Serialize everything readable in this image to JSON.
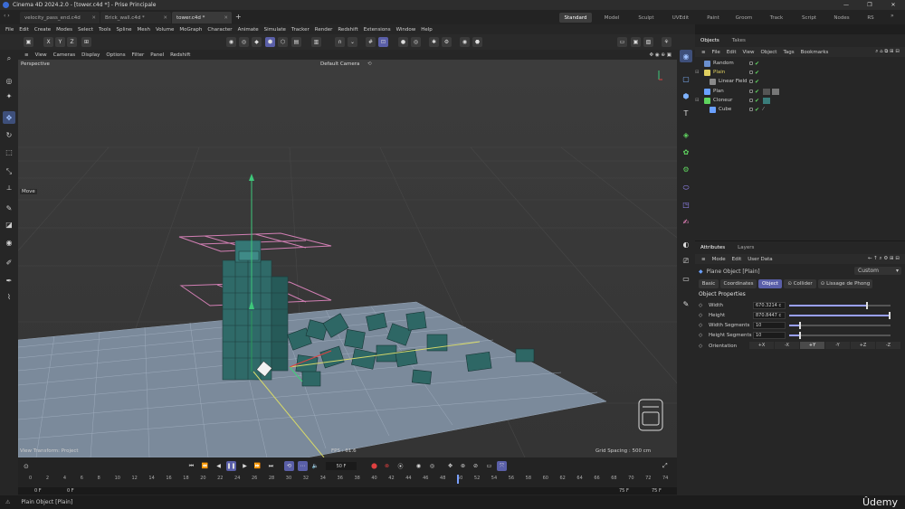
{
  "window": {
    "title": "Cinema 4D 2024.2.0 - [tower.c4d *] - Prise Principale",
    "controls": [
      "—",
      "❐",
      "✕"
    ]
  },
  "doc_tabs": [
    {
      "label": "velocity_pass_end.c4d"
    },
    {
      "label": "Brick_wall.c4d *"
    },
    {
      "label": "tower.c4d *"
    }
  ],
  "layouts": [
    "Standard",
    "Model",
    "Sculpt",
    "UVEdit",
    "Paint",
    "Groom",
    "Track",
    "Script",
    "Nodes",
    "RS"
  ],
  "menu": [
    "File",
    "Edit",
    "Create",
    "Modes",
    "Select",
    "Tools",
    "Spline",
    "Mesh",
    "Volume",
    "MoGraph",
    "Character",
    "Animate",
    "Simulate",
    "Tracker",
    "Render",
    "Redshift",
    "Extensions",
    "Window",
    "Help"
  ],
  "viewport_menu": [
    "View",
    "Cameras",
    "Display",
    "Options",
    "Filter",
    "Panel",
    "Redshift"
  ],
  "viewport": {
    "name": "Perspective",
    "camera": "Default Camera",
    "move_label": "Move",
    "transform_label": "View Transform: Project",
    "fps": "FPS : 61.6",
    "grid_spacing": "Grid Spacing : 500 cm"
  },
  "objects_panel": {
    "tabs": [
      "Objects",
      "Takes"
    ],
    "menu": [
      "File",
      "Edit",
      "View",
      "Object",
      "Tags",
      "Bookmarks"
    ],
    "items": [
      {
        "label": "Random",
        "color": "#6a8fcf"
      },
      {
        "label": "Plain",
        "color": "#e0d060"
      },
      {
        "label": "Linear Field",
        "color": "#cfcfcf"
      },
      {
        "label": "Plan",
        "color": "#6aa0ff"
      },
      {
        "label": "Cloneur",
        "color": "#5fd45f"
      },
      {
        "label": "Cube",
        "color": "#6aa0ff"
      }
    ]
  },
  "attributes_panel": {
    "tabs": [
      "Attributes",
      "Layers"
    ],
    "menu": [
      "Mode",
      "Edit",
      "User Data"
    ],
    "object_title": "Plane Object [Plain]",
    "preset": "Custom",
    "sub_tabs": [
      "Basic",
      "Coordinates",
      "Object",
      "Collider",
      "Lissage de Phong"
    ],
    "active_sub_tab": "Object",
    "section_title": "Object Properties",
    "properties": [
      {
        "label": "Width",
        "value": "670.3214 c",
        "fill": 0.76
      },
      {
        "label": "Height",
        "value": "870.8447 c",
        "fill": 0.98
      },
      {
        "label": "Width Segments",
        "value": "10",
        "fill": 0.1
      },
      {
        "label": "Height Segments",
        "value": "10",
        "fill": 0.1
      }
    ],
    "orientation_label": "Orientation",
    "orientations": [
      "+X",
      "-X",
      "+Y",
      "-Y",
      "+Z",
      "-Z"
    ],
    "active_orientation": "+Y"
  },
  "timeline": {
    "current_frame": "50 F",
    "ticks": [
      "0",
      "2",
      "4",
      "6",
      "8",
      "10",
      "12",
      "14",
      "16",
      "18",
      "20",
      "22",
      "24",
      "26",
      "28",
      "30",
      "32",
      "34",
      "36",
      "38",
      "40",
      "42",
      "44",
      "46",
      "48",
      "50",
      "52",
      "54",
      "56",
      "58",
      "60",
      "62",
      "64",
      "66",
      "68",
      "70",
      "72",
      "74"
    ],
    "start": "0 F",
    "start2": "0 F",
    "end": "75 F",
    "end2": "75 F"
  },
  "status": {
    "text": "Plain Object [Plain]",
    "brand": "Ûdemy"
  }
}
